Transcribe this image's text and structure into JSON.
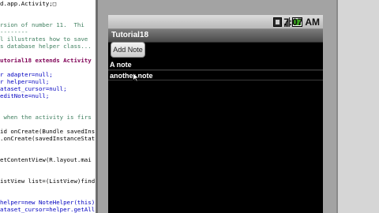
{
  "editor": {
    "lines": [
      {
        "text": "d.app.Activity;□",
        "style": "c-normal"
      },
      {
        "text": "",
        "style": "c-normal"
      },
      {
        "text": "",
        "style": "c-normal"
      },
      {
        "text": "rsion of number 11.  Thi",
        "style": "c-comment"
      },
      {
        "text": "--------",
        "style": "c-comment"
      },
      {
        "text": "l illustrates how to save",
        "style": "c-comment"
      },
      {
        "text": "s database helper class...",
        "style": "c-comment"
      },
      {
        "text": "",
        "style": "c-normal"
      },
      {
        "text": "utorial18 extends Activity",
        "style": "c-keyword"
      },
      {
        "text": "",
        "style": "c-normal"
      },
      {
        "text": "r adapter=null;",
        "style": "c-field"
      },
      {
        "text": "r helper=null;",
        "style": "c-field"
      },
      {
        "text": "ataset_cursor=null;",
        "style": "c-field"
      },
      {
        "text": "editNote=null;",
        "style": "c-field"
      },
      {
        "text": "",
        "style": "c-normal"
      },
      {
        "text": "",
        "style": "c-normal"
      },
      {
        "text": " when the activity is firs",
        "style": "c-comment"
      },
      {
        "text": "",
        "style": "c-normal"
      },
      {
        "text": "id onCreate(Bundle savedIns",
        "style": "c-normal"
      },
      {
        "text": ".onCreate(savedInstanceStat",
        "style": "c-normal"
      },
      {
        "text": "",
        "style": "c-normal"
      },
      {
        "text": "",
        "style": "c-normal"
      },
      {
        "text": "etContentView(R.layout.mai",
        "style": "c-normal"
      },
      {
        "text": "",
        "style": "c-normal"
      },
      {
        "text": "",
        "style": "c-normal"
      },
      {
        "text": "istView list=(ListView)find",
        "style": "c-normal"
      },
      {
        "text": "",
        "style": "c-normal"
      },
      {
        "text": "",
        "style": "c-normal"
      },
      {
        "text": "helper=new NoteHelper(this);",
        "style": "c-field"
      },
      {
        "text": "ataset_cursor=helper.getAll",
        "style": "c-field"
      }
    ]
  },
  "status": {
    "time": "7:07 AM",
    "icons": [
      "sim-icon",
      "signal-icon",
      "battery-icon"
    ],
    "battery_color": "#3aa31e"
  },
  "app": {
    "title": "Tutorial18",
    "add_button_label": "Add Note",
    "notes": [
      "A note",
      "another note"
    ]
  }
}
